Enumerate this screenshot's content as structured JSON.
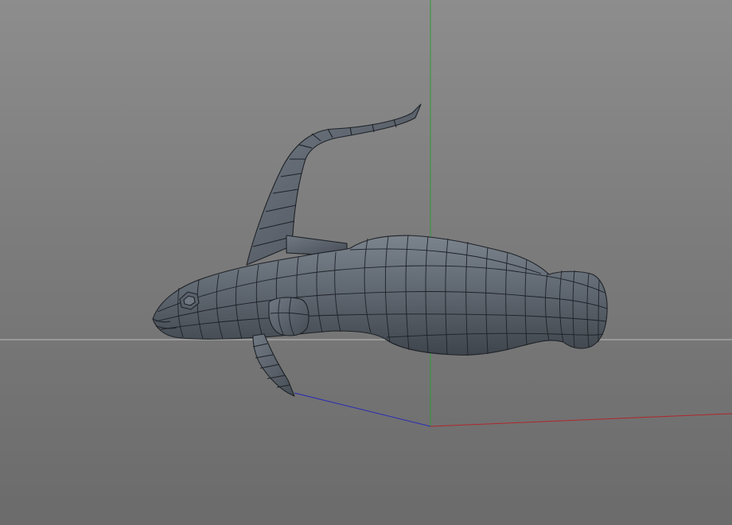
{
  "viewport": {
    "projection": "perspective",
    "shading": "gouraud-with-wireframe",
    "background_color": "#808080"
  },
  "scene": {
    "object_name": "",
    "object_kind": "low-poly fish mesh",
    "mesh_color": "#5f6770",
    "edge_color": "#1e2227"
  },
  "axes": {
    "x_color": "#b0262a",
    "y_color": "#2e9a3a",
    "z_color": "#2a2ab8",
    "horizon_color": "#b9b9b9"
  }
}
